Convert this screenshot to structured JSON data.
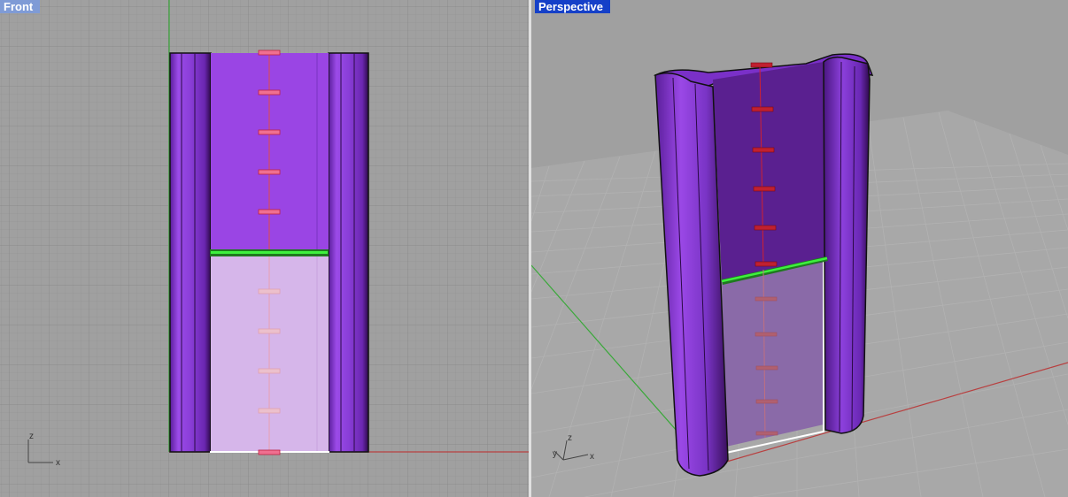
{
  "viewports": {
    "front": {
      "title": "Front",
      "axes": {
        "x": "x",
        "z": "z"
      }
    },
    "perspective": {
      "title": "Perspective",
      "axes": {
        "x": "x",
        "y": "y",
        "z": "z"
      }
    }
  },
  "colors": {
    "background": "#a0a0a0",
    "grid_minor": "#969696",
    "grid_major": "#8a8a8a",
    "x_axis": "#b84040",
    "y_axis": "#3aa83a",
    "model_purple": "#8a3ed8",
    "model_dark": "#3a105e",
    "glass": "#d6b6ea",
    "ruler_red": "#e04a4a",
    "green_bar": "#2fd12f",
    "active_title": "#1540c8",
    "inactive_title": "#7f9bd6"
  },
  "icons": [
    "axis-triad-icon"
  ]
}
